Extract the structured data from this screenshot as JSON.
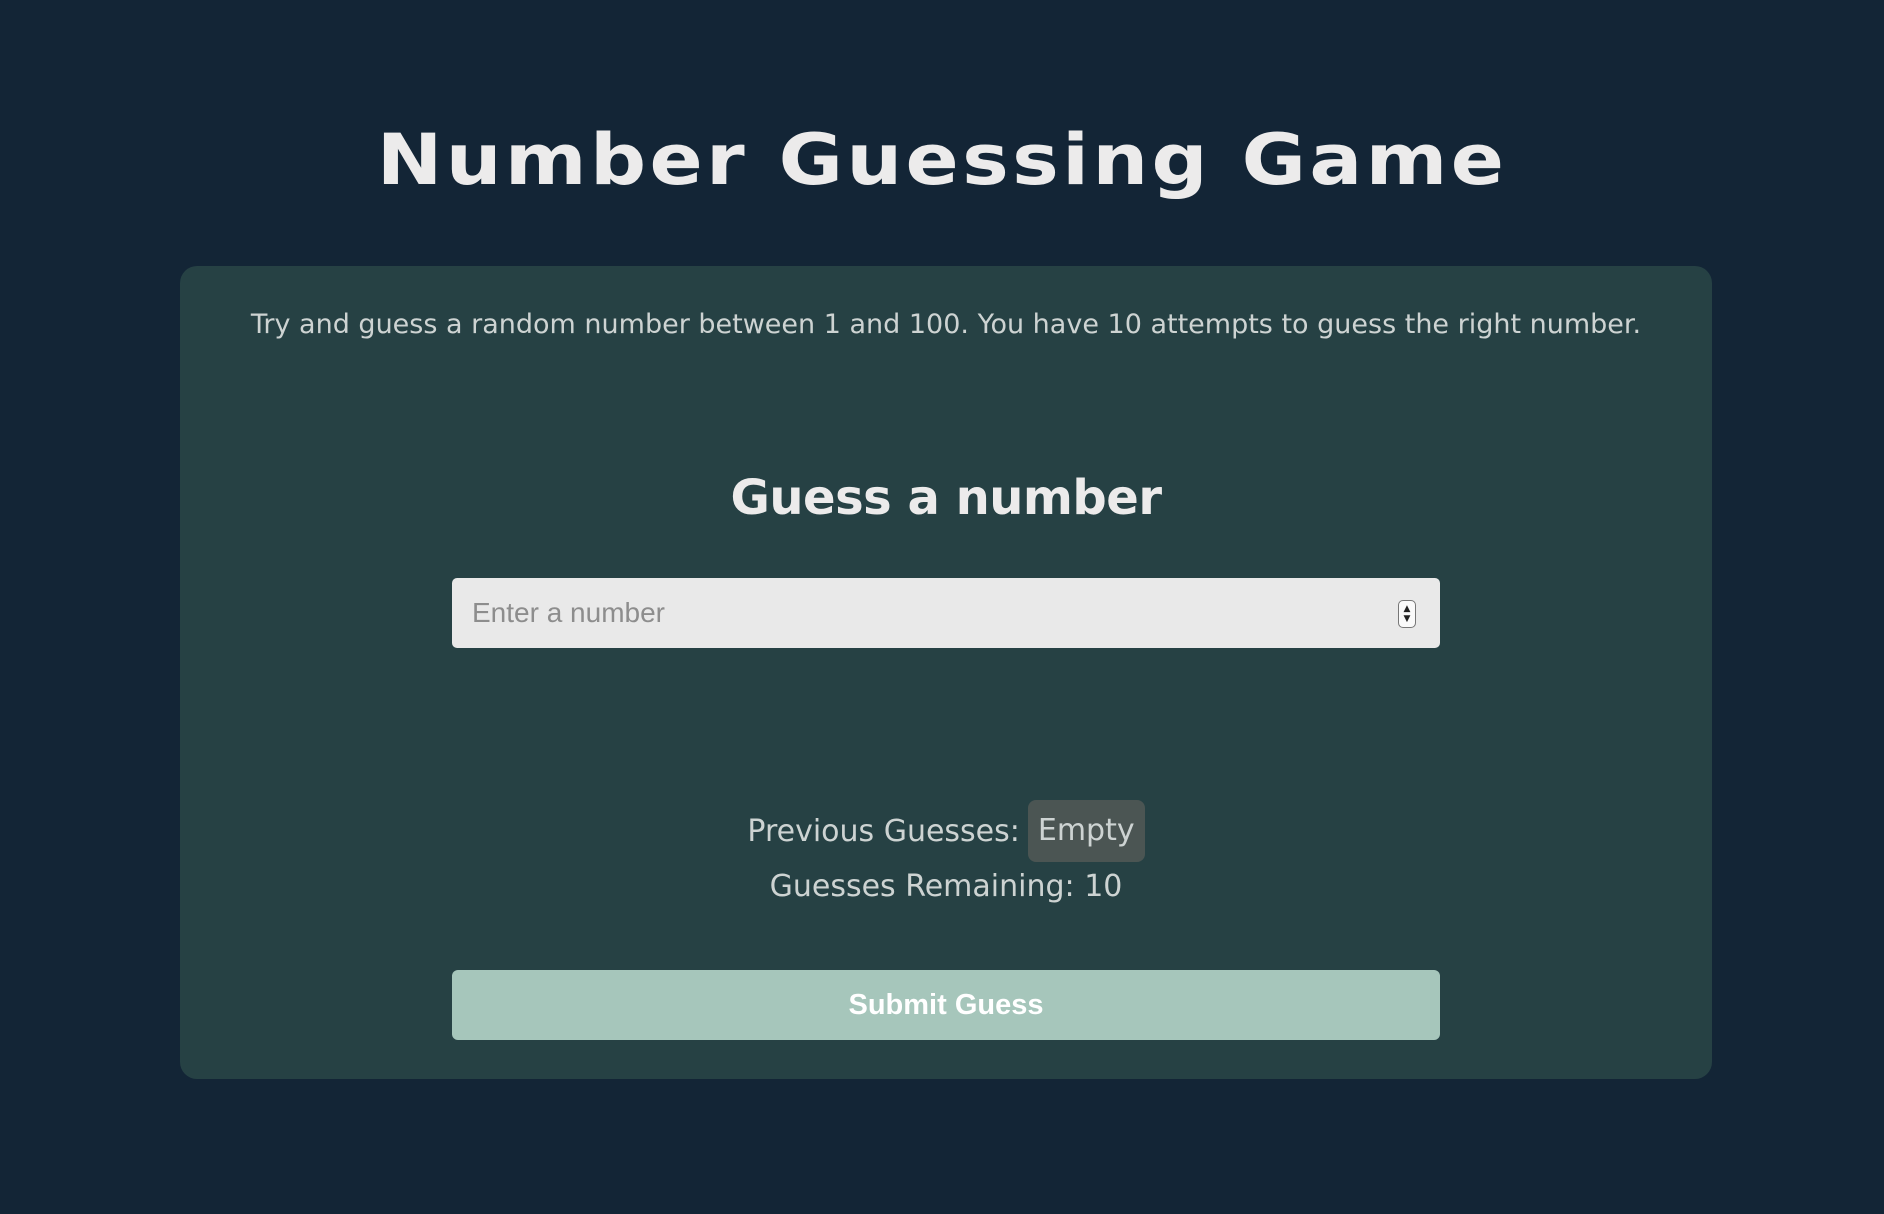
{
  "header": {
    "title": "Number Guessing Game"
  },
  "card": {
    "intro": "Try and guess a random number between 1 and 100. You have 10 attempts to guess the right number.",
    "heading": "Guess a number",
    "input": {
      "placeholder": "Enter a number",
      "value": ""
    },
    "previous_guesses": {
      "label": "Previous Guesses:",
      "value": "Empty"
    },
    "guesses_remaining": {
      "label": "Guesses Remaining:",
      "value": "10"
    },
    "submit_label": "Submit Guess"
  },
  "colors": {
    "background": "#132536",
    "card": "#264144",
    "button": "#a6c6bb",
    "badge": "#4b5553",
    "input": "#e9e9e9"
  },
  "icons": {
    "stepper": "number-stepper-icon"
  }
}
